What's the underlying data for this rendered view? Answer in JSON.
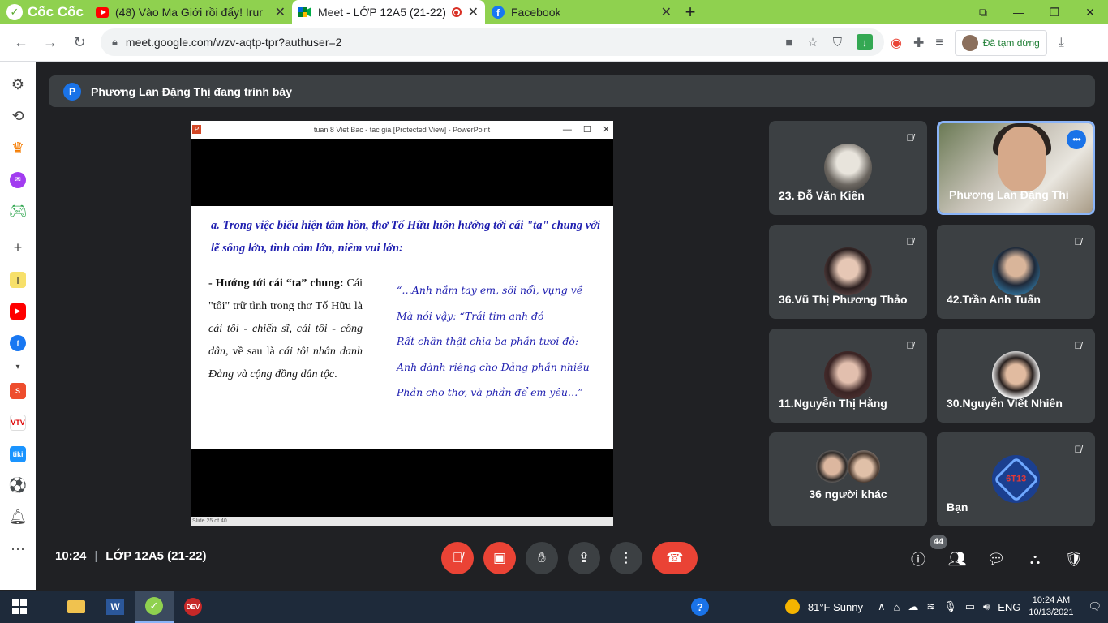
{
  "browser": {
    "brand": "Cốc Cốc",
    "tabs": [
      {
        "title": "(48) Vào Ma Giới rồi đấy! Irur",
        "icon": "youtube-icon"
      },
      {
        "title": "Meet - LỚP 12A5 (21-22)",
        "icon": "meet-icon",
        "active": true
      },
      {
        "title": "Facebook",
        "icon": "facebook-icon"
      }
    ],
    "url": "meet.google.com/wzv-aqtp-tpr?authuser=2",
    "profile_status": "Đã tạm dừng"
  },
  "meet": {
    "presenting_banner": "Phương Lan Đặng Thị đang trình bày",
    "presenter_initial": "P",
    "shared_window": {
      "title": "tuan 8 Viet Bac - tac gia [Protected View] - PowerPoint",
      "status_text": "Slide 25 of 40",
      "slide": {
        "heading": "a. Trong việc biểu hiện tâm hồn, thơ Tố Hữu luôn hướng tới cái \"ta\" chung với lẽ sống lớn, tình cảm lớn, niềm vui lớn:",
        "left_bold": "- Hướng tới cái “ta” chung:",
        "left_text_1": " Cái \"tôi\" trữ tình trong thơ Tố Hữu là ",
        "left_italic_1": "cái tôi - chiến sĩ, cái tôi - công dân",
        "left_text_2": ", về sau là ",
        "left_italic_2": "cái tôi nhân danh Đảng và cộng đồng dân tộc",
        "left_text_3": ".",
        "quote_lines": [
          "“…Anh nắm tay em, sôi nổi, vụng về",
          "Mà nói vậy: “Trái tim anh đó",
          "Rất chân thật chia ba phần tươi đỏ:",
          "Anh dành riêng cho Đảng phần nhiều",
          "Phần cho thơ, và phần để em yêu…”"
        ]
      }
    },
    "participants": [
      {
        "name": "23. Đỗ Văn Kiên",
        "muted": true
      },
      {
        "name": "Phương Lan Đặng Thị",
        "speaking": true
      },
      {
        "name": "36.Vũ Thị Phương Thảo",
        "muted": true
      },
      {
        "name": "42.Trần Anh Tuấn",
        "muted": true
      },
      {
        "name": "11.Nguyễn Thị Hằng",
        "muted": true
      },
      {
        "name": "30.Nguyễn Viết Nhiên",
        "muted": true
      },
      {
        "name": "36 người khác"
      },
      {
        "name": "Bạn",
        "muted": true,
        "avatar_text": "6T13"
      }
    ],
    "bottom": {
      "time": "10:24",
      "meeting_name": "LỚP 12A5 (21-22)",
      "people_count": "44"
    }
  },
  "taskbar": {
    "weather": "81°F  Sunny",
    "language": "ENG",
    "time": "10:24 AM",
    "date": "10/13/2021"
  }
}
